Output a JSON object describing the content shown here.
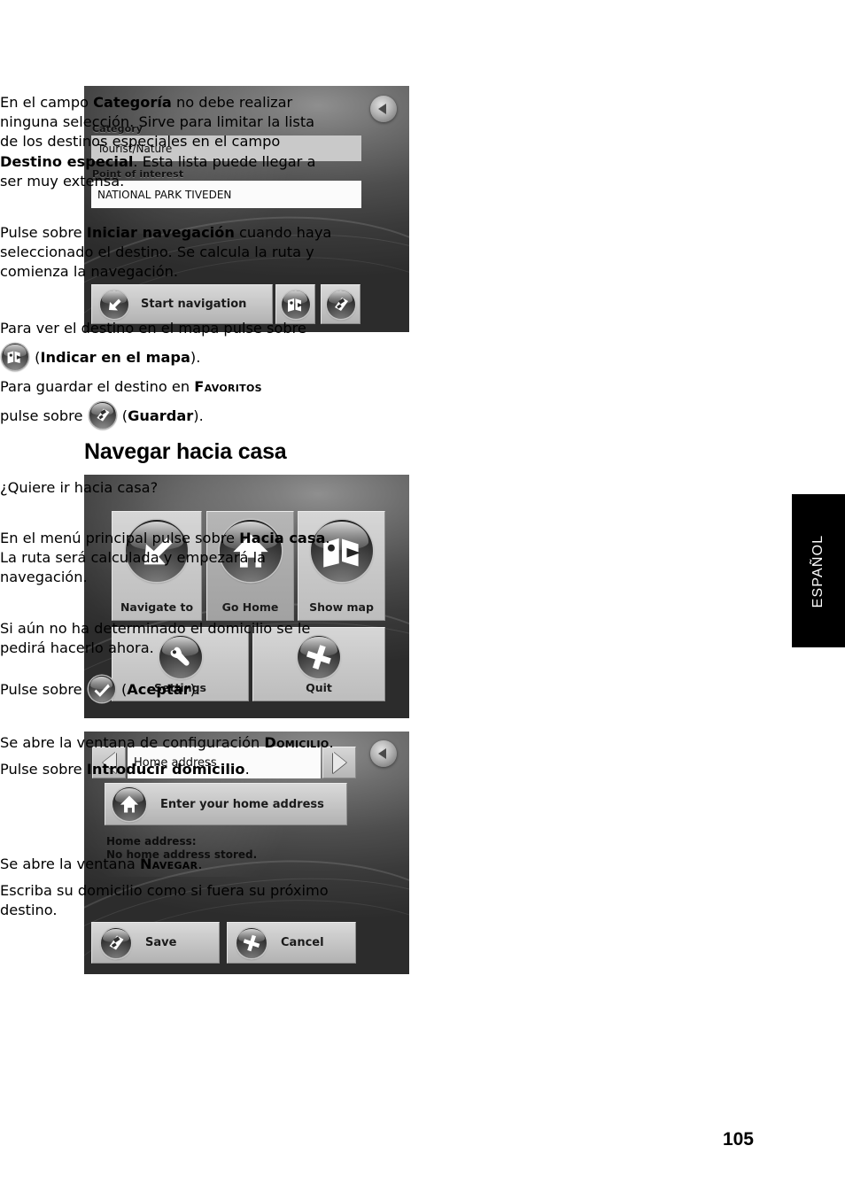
{
  "page": {
    "number": "105",
    "language_tab": "ESPAÑOL",
    "heading": "Navegar hacia casa"
  },
  "body_text": {
    "p1_a": "En el campo ",
    "p1_b": "Categoría",
    "p1_c": " no debe realizar ninguna selección. Sirve para limitar la lista de los destinos especiales en el campo ",
    "p1_d": "Destino especial",
    "p1_e": ". Esta lista puede llegar a ser muy extensa.",
    "p2_a": "Pulse sobre ",
    "p2_b": "Iniciar navegación",
    "p2_c": " cuando haya seleccionado el destino. Se calcula la ruta y comienza la navegación.",
    "p3_a": "Para ver el destino en el mapa pulse sobre ",
    "p3_b": " (",
    "p3_c": "Indicar en el mapa",
    "p3_d": ").",
    "p4_a": "Para guardar el destino en ",
    "p4_b": "Favoritos",
    "p5_a": "pulse sobre ",
    "p5_b": " (",
    "p5_c": "Guardar",
    "p5_d": ").",
    "p6": "¿Quiere ir hacia casa?",
    "p7_a": "En el menú principal pulse sobre ",
    "p7_b": "Hacia casa",
    "p7_c": ". La ruta será calculada y empezará la navegación.",
    "p8": "Si aún no ha determinado el domicilio se le pedirá hacerlo ahora.",
    "p9_a": "Pulse sobre ",
    "p9_b": " (",
    "p9_c": "Aceptar",
    "p9_d": ").",
    "p10_a": "Se abre la ventana de configuración ",
    "p10_b": "Domicilio",
    "p10_c": ".",
    "p11_a": "Pulse sobre ",
    "p11_b": "Introducir domicilio",
    "p11_c": ".",
    "p12_a": "Se abre la ventana ",
    "p12_b": "Navegar",
    "p12_c": ".",
    "p13": "Escriba su domicilio como si fuera su próximo destino."
  },
  "screenshot_poi": {
    "category_label": "Category",
    "category_value": "Tourist/Nature",
    "poi_label": "Point of interest",
    "poi_value": "NATIONAL PARK TIVEDEN",
    "start_navigation_label": "Start navigation",
    "back_icon": "back-arrow-icon",
    "show_map_icon": "map-icon",
    "save_icon": "save-icon",
    "start_icon": "navigate-arrow-icon"
  },
  "screenshot_mainmenu": {
    "tiles": [
      {
        "label": "Navigate to",
        "icon": "navigate-arrow-icon"
      },
      {
        "label": "Go Home",
        "icon": "house-icon"
      },
      {
        "label": "Show map",
        "icon": "map-icon"
      },
      {
        "label": "Settings",
        "icon": "wrench-icon"
      },
      {
        "label": "Quit",
        "icon": "close-x-icon"
      }
    ]
  },
  "screenshot_homeaddress": {
    "title_value": "Home address",
    "prev_icon": "chevron-left-icon",
    "next_icon": "chevron-right-icon",
    "back_icon": "back-arrow-icon",
    "enter_button_label": "Enter your home address",
    "enter_button_icon": "house-icon",
    "status_text": "Home address:\nNo home address stored.",
    "save_label": "Save",
    "save_icon": "save-icon",
    "cancel_label": "Cancel",
    "cancel_icon": "close-x-icon"
  },
  "colors": {
    "page_background": "#ffffff",
    "text": "#000000",
    "tab_background": "#000000",
    "tab_text": "#ffffff",
    "device_field_grey": "#c9c9c9",
    "device_field_white": "#fbfbfb"
  }
}
